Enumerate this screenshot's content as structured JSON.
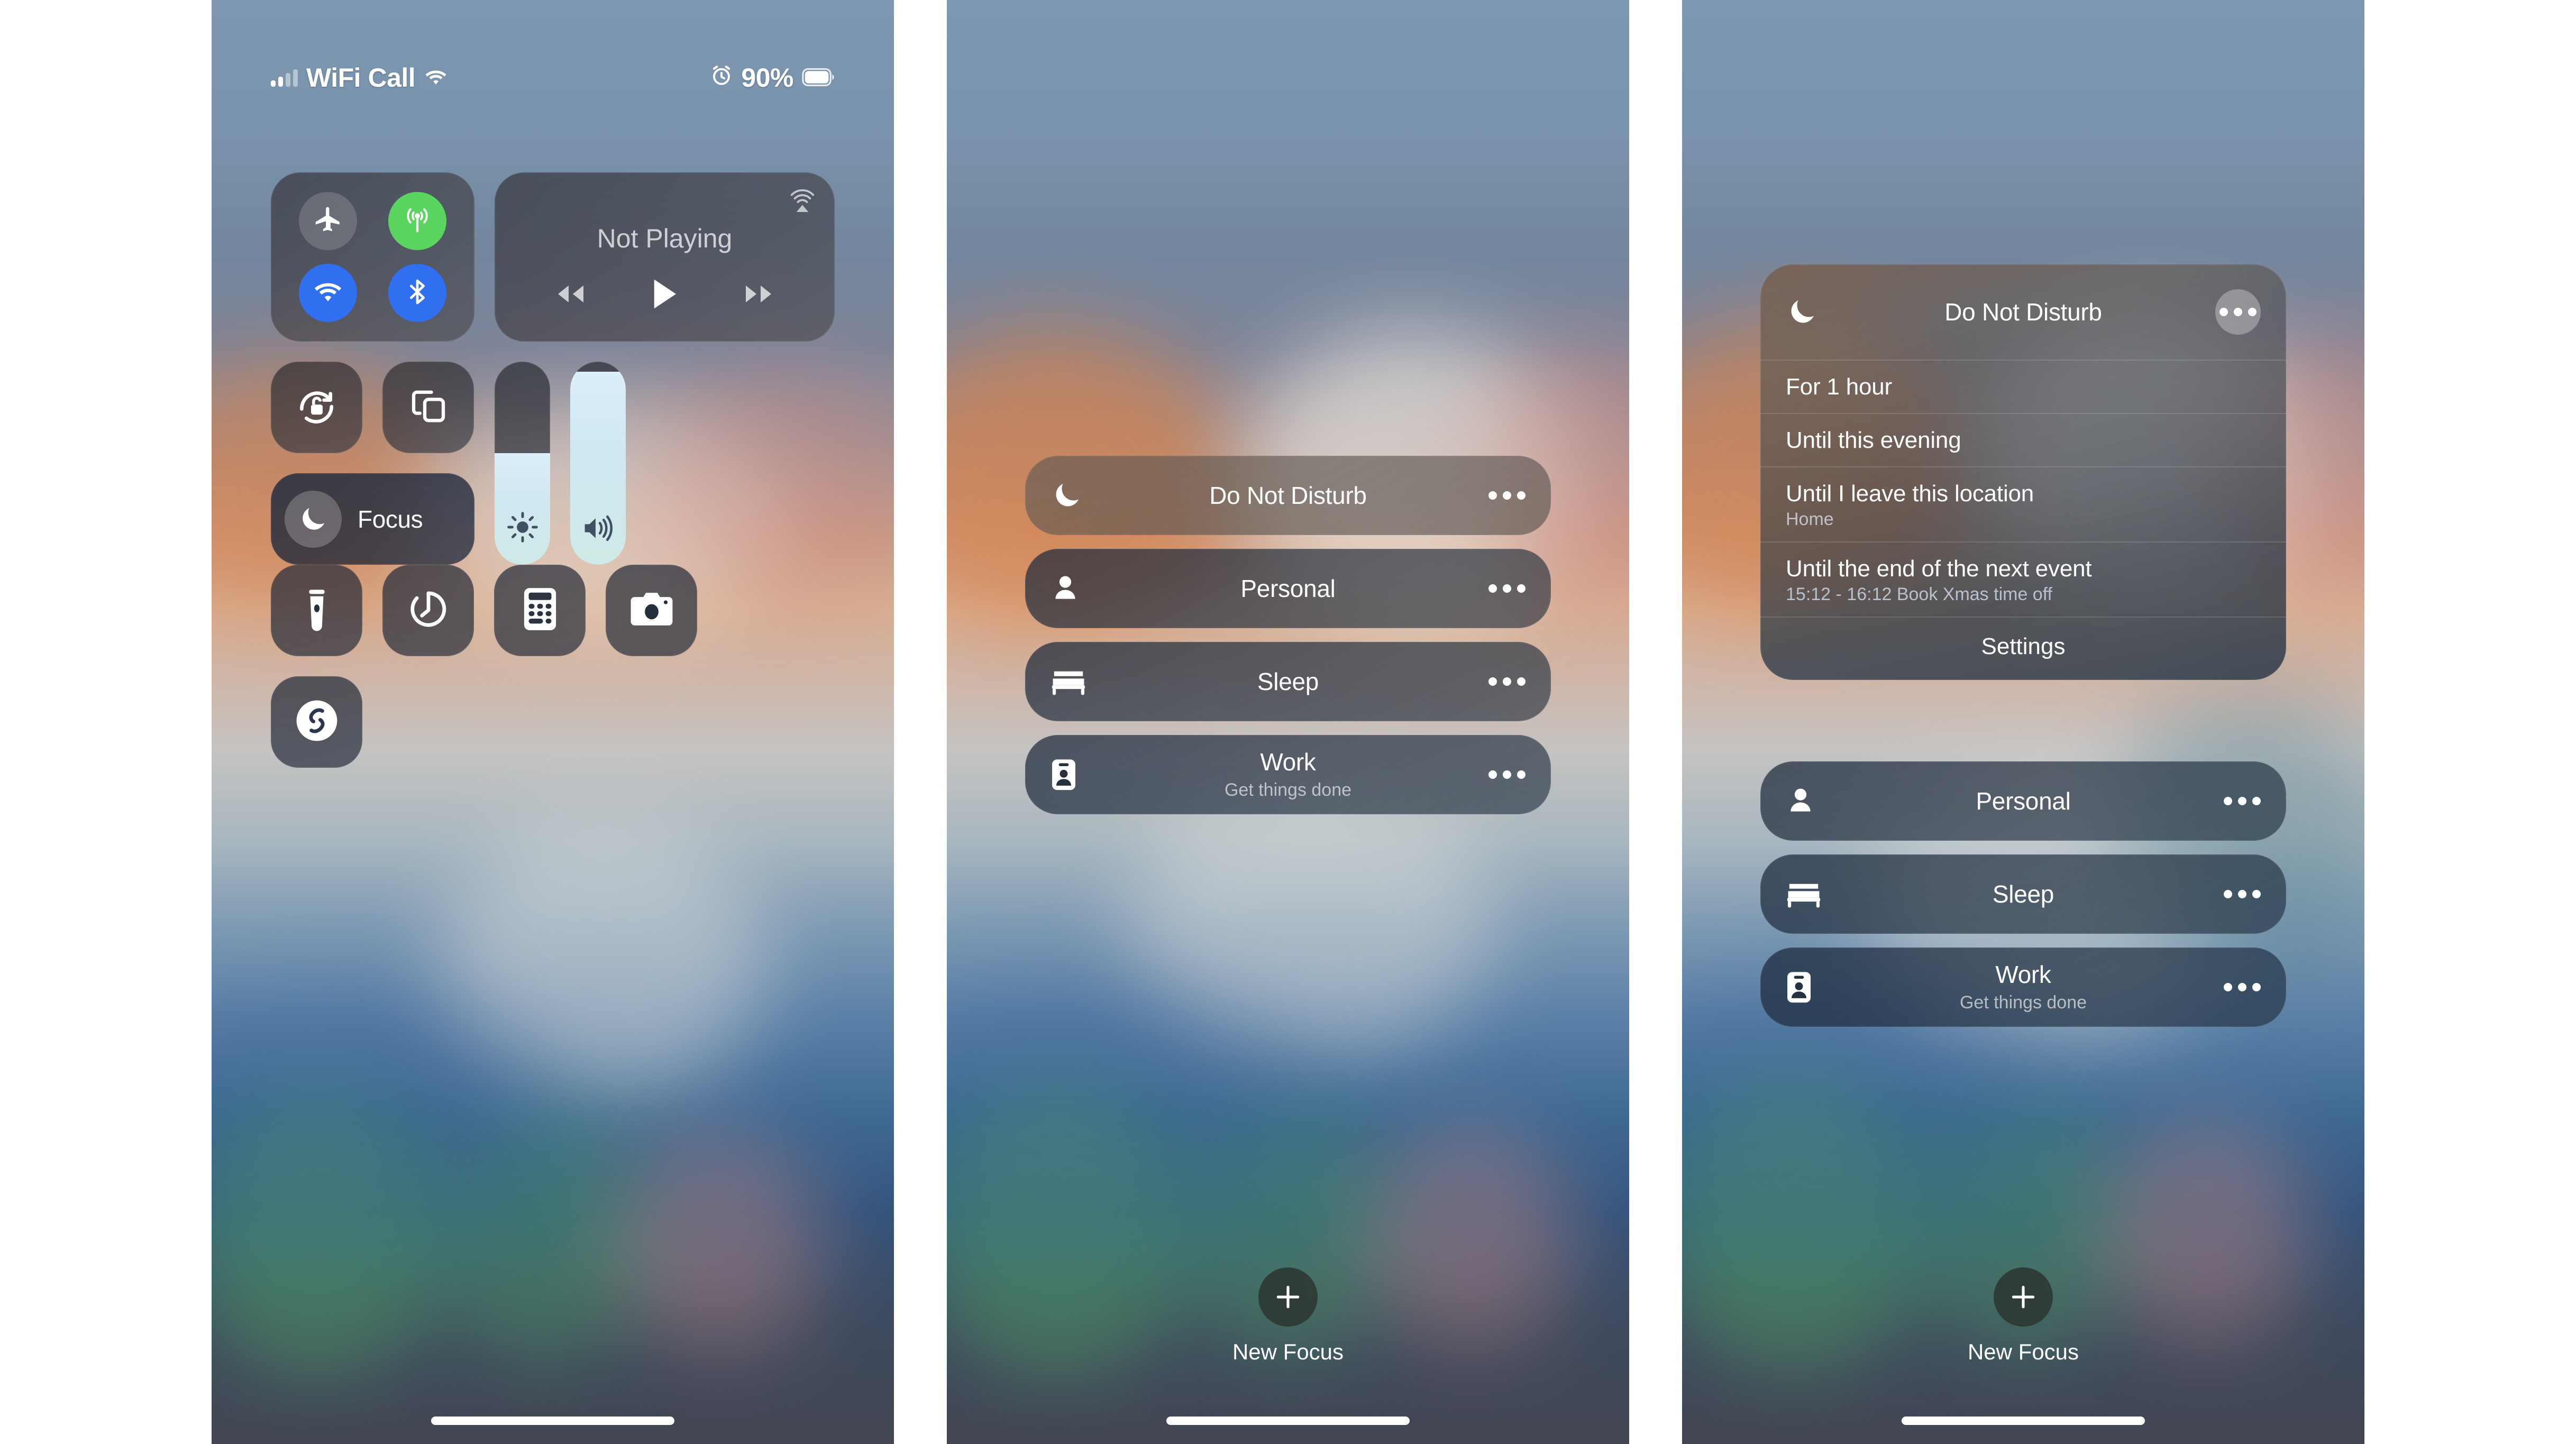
{
  "status_bar": {
    "signal_icon": "cellular-bars-icon",
    "carrier": "WiFi Call",
    "wifi_icon": "wifi-icon",
    "alarm_icon": "alarm-clock-icon",
    "battery_percent": "90%",
    "battery_icon": "battery-icon"
  },
  "control_center": {
    "connectivity": {
      "airplane": {
        "label": "Airplane Mode",
        "icon": "airplane-icon",
        "state": "off"
      },
      "cellular": {
        "label": "Cellular Data",
        "icon": "cellular-antenna-icon",
        "state": "on",
        "color": "#5bd55f"
      },
      "wifi": {
        "label": "Wi-Fi",
        "icon": "wifi-icon",
        "state": "on",
        "color": "#2f6ff0"
      },
      "bluetooth": {
        "label": "Bluetooth",
        "icon": "bluetooth-icon",
        "state": "on",
        "color": "#2f6ff0"
      }
    },
    "media": {
      "title": "Not Playing",
      "airplay_icon": "airplay-icon",
      "rewind_icon": "rewind-icon",
      "play_icon": "play-icon",
      "forward_icon": "fast-forward-icon"
    },
    "rotation_lock": {
      "label": "Rotation Lock",
      "icon": "rotation-lock-icon"
    },
    "screen_mirroring": {
      "label": "Screen Mirroring",
      "icon": "screen-mirroring-icon"
    },
    "focus_tile": {
      "label": "Focus",
      "icon": "moon-icon"
    },
    "brightness": {
      "label": "Brightness",
      "icon": "brightness-icon",
      "value_percent": 55
    },
    "volume": {
      "label": "Volume",
      "icon": "volume-icon",
      "value_percent": 95
    },
    "shortcuts": [
      {
        "label": "Flashlight",
        "icon": "flashlight-icon"
      },
      {
        "label": "Timer",
        "icon": "timer-icon"
      },
      {
        "label": "Calculator",
        "icon": "calculator-icon"
      },
      {
        "label": "Camera",
        "icon": "camera-icon"
      },
      {
        "label": "Shazam",
        "icon": "shazam-icon"
      }
    ]
  },
  "focus_list": {
    "items": [
      {
        "title": "Do Not Disturb",
        "subtitle": "",
        "icon": "moon-icon",
        "more_icon": "ellipsis-icon"
      },
      {
        "title": "Personal",
        "subtitle": "",
        "icon": "person-icon",
        "more_icon": "ellipsis-icon"
      },
      {
        "title": "Sleep",
        "subtitle": "",
        "icon": "bed-icon",
        "more_icon": "ellipsis-icon"
      },
      {
        "title": "Work",
        "subtitle": "Get things done",
        "icon": "badge-icon",
        "more_icon": "ellipsis-icon"
      }
    ],
    "new_focus": {
      "label": "New Focus",
      "icon": "plus-icon"
    }
  },
  "dnd_expanded": {
    "title": "Do Not Disturb",
    "icon": "moon-icon",
    "more_icon": "ellipsis-icon",
    "options": [
      {
        "title": "For 1 hour",
        "subtitle": ""
      },
      {
        "title": "Until this evening",
        "subtitle": ""
      },
      {
        "title": "Until I leave this location",
        "subtitle": "Home"
      },
      {
        "title": "Until the end of the next event",
        "subtitle": "15:12 - 16:12 Book Xmas time off"
      }
    ],
    "settings_label": "Settings"
  },
  "colors": {
    "accent_green": "#5bd55f",
    "accent_blue": "#2f6ff0",
    "slider_fill": "#dbeefb"
  }
}
